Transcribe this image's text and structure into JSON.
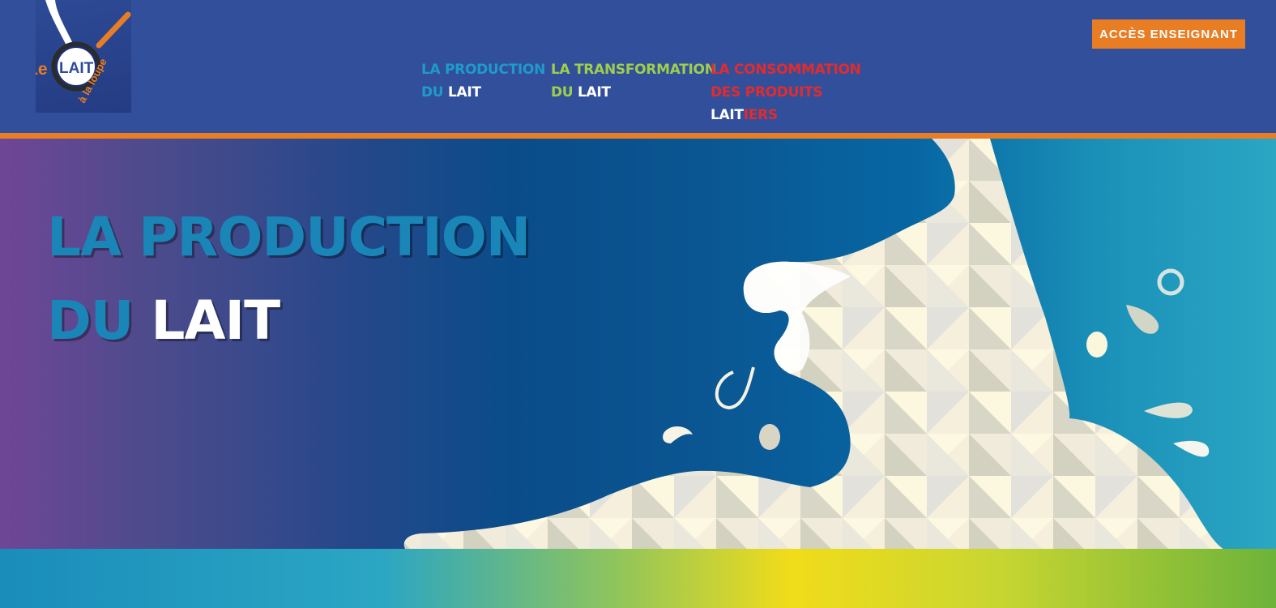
{
  "logo": {
    "text_le": "Le",
    "text_lait": "LAIT",
    "text_loupe": "à la loupe",
    "icon": "magnifier-milk-logo"
  },
  "nav": {
    "production": {
      "line1": "LA PRODUCTION",
      "line2_a": "DU",
      "line2_b": "LAIT"
    },
    "transformation": {
      "line1": "LA TRANSFORMATION",
      "line2_a": "DU",
      "line2_b": "LAIT"
    },
    "consommation": {
      "line1": "LA CONSOMMATION",
      "line2": "DES PRODUITS",
      "line3_a": "LAIT",
      "line3_b": "IERS"
    }
  },
  "teacher_button": {
    "label": "ACCÈS ENSEIGNANT"
  },
  "hero": {
    "title_line1": "LA PRODUCTION",
    "title_line2_a": "DU",
    "title_line2_b": "LAIT"
  },
  "colors": {
    "header_bg": "#324f9c",
    "accent_orange": "#e87d24",
    "nav_blue": "#1e9bc9",
    "nav_green": "#9fcf4a",
    "nav_red": "#e42b2b"
  }
}
